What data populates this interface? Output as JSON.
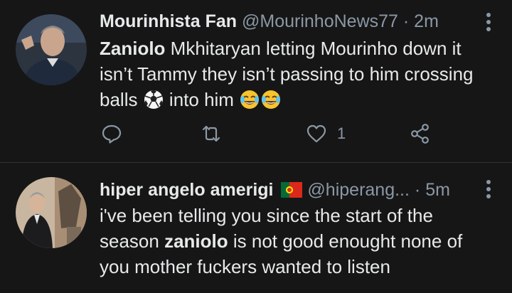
{
  "tweets": [
    {
      "author_name": "Mourinhista Fan",
      "handle": "@MourinhoNews77",
      "separator": "·",
      "time": "2m",
      "more_icon": "more-vertical-icon",
      "text_bold": "Zaniolo",
      "text_line1_rest": " Mkhitaryan letting Mourinho down it",
      "text_line2": "isn’t Tammy they isn’t passing to him crossing",
      "text_line3a": "balls ",
      "text_line3b": " into him ",
      "emojis": [
        "soccer-ball-icon",
        "laughing-crying-emoji-icon",
        "laughing-crying-emoji-icon"
      ],
      "actions": {
        "reply_icon": "reply-icon",
        "retweet_icon": "retweet-icon",
        "like_icon": "heart-icon",
        "like_count": "1",
        "share_icon": "share-icon"
      }
    },
    {
      "author_name": "hiper angelo amerigi",
      "flag_icon": "portugal-flag-icon",
      "handle": "@hiperang...",
      "separator": "·",
      "time": "5m",
      "more_icon": "more-vertical-icon",
      "text_line1": "i've been telling you since the start of the",
      "text_line2a": "season ",
      "text_bold": "zaniolo",
      "text_line2b": " is not good enought none of",
      "text_line3": "you mother fuckers wanted to listen"
    }
  ],
  "colors": {
    "background": "#161616",
    "text": "#e7e9ea",
    "muted": "#8b98a5",
    "divider": "#2f3336"
  }
}
